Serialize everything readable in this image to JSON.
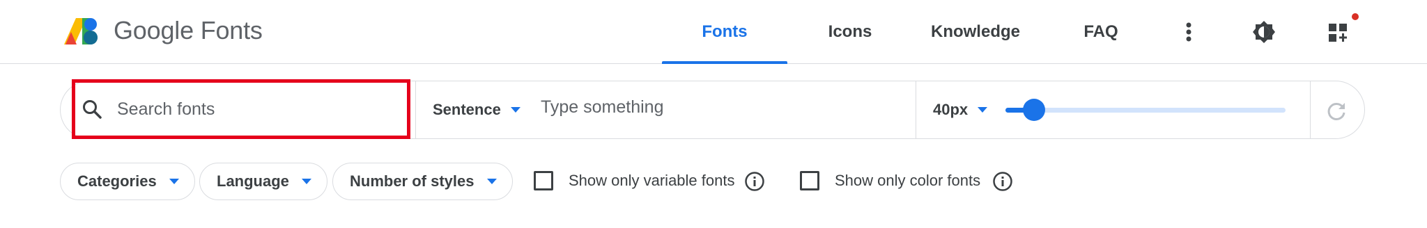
{
  "header": {
    "brand": "Google Fonts",
    "nav": [
      {
        "label": "Fonts",
        "active": true
      },
      {
        "label": "Icons",
        "active": false
      },
      {
        "label": "Knowledge",
        "active": false
      },
      {
        "label": "FAQ",
        "active": false
      }
    ],
    "icons": [
      "more-vert-icon",
      "theme-toggle-icon",
      "apps-grid-icon"
    ],
    "notification_dot_color": "#d93025"
  },
  "search": {
    "placeholder": "Search fonts",
    "highlight_color": "#e5001b"
  },
  "preview": {
    "mode": "Sentence",
    "text_placeholder": "Type something",
    "size": "40px",
    "size_level": 0.08
  },
  "filters": {
    "chips": [
      "Categories",
      "Language",
      "Number of styles"
    ],
    "checkboxes": [
      {
        "label": "Show only variable fonts",
        "checked": false
      },
      {
        "label": "Show only color fonts",
        "checked": false
      }
    ]
  },
  "colors": {
    "accent": "#1a73e8",
    "text": "#3c4043",
    "border": "#dadce0"
  }
}
